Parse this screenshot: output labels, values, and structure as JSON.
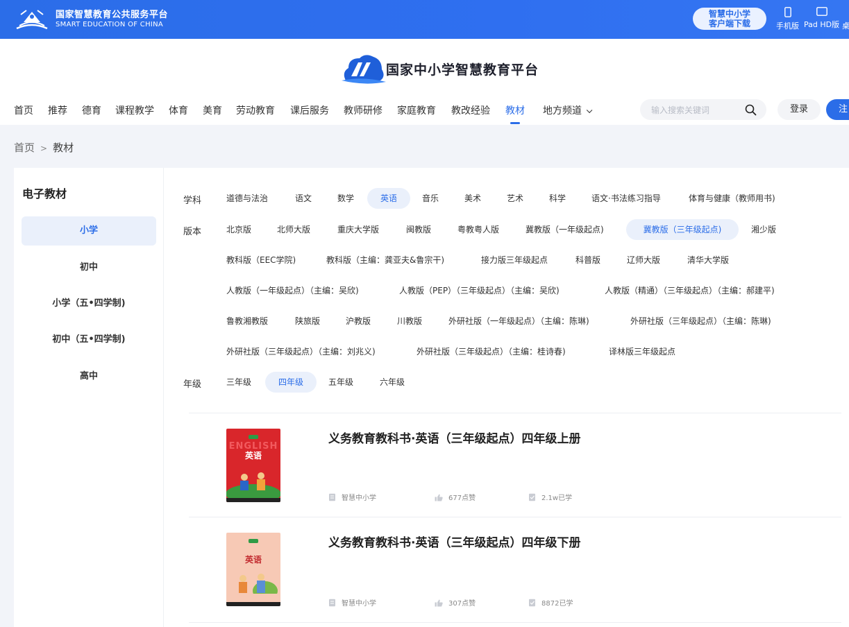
{
  "topbar": {
    "brand_cn": "国家智慧教育公共服务平台",
    "brand_en": "SMART EDUCATION OF CHINA",
    "client_line1": "智慧中小学",
    "client_line2": "客户端下载",
    "devices": [
      "手机版",
      "Pad HD版",
      "桌"
    ]
  },
  "header": {
    "site_title": "国家中小学智慧教育平台",
    "nav": [
      "首页",
      "推荐",
      "德育",
      "课程教学",
      "体育",
      "美育",
      "劳动教育",
      "课后服务",
      "教师研修",
      "家庭教育",
      "教改经验",
      "教材",
      "地方频道"
    ],
    "nav_active": "教材",
    "search_placeholder": "输入搜索关键词",
    "login": "登录",
    "register": "注"
  },
  "breadcrumb": {
    "home": "首页",
    "sep": ">",
    "current": "教材"
  },
  "sidebar": {
    "title": "电子教材",
    "stages": [
      "小学",
      "初中",
      "小学（五•四学制)",
      "初中（五•四学制)",
      "高中"
    ],
    "active": "小学"
  },
  "filters": {
    "subject_label": "学科",
    "subjects": [
      "道德与法治",
      "语文",
      "数学",
      "英语",
      "音乐",
      "美术",
      "艺术",
      "科学",
      "语文·书法练习指导",
      "体育与健康（教师用书)"
    ],
    "subject_active": "英语",
    "edition_label": "版本",
    "editions": [
      "北京版",
      "北师大版",
      "重庆大学版",
      "闽教版",
      "粤教粤人版",
      "冀教版（一年级起点)",
      "冀教版（三年级起点)",
      "湘少版",
      "教科版（EEC学院)",
      "教科版（主编：龚亚夫&鲁宗干)",
      "接力版三年级起点",
      "科普版",
      "辽师大版",
      "清华大学版",
      "人教版（一年级起点）（主编：吴欣)",
      "人教版（PEP）（三年级起点）（主编：吴欣)",
      "人教版（精通）（三年级起点）（主编：郝建平)",
      "鲁教湘教版",
      "陕旅版",
      "沪教版",
      "川教版",
      "外研社版（一年级起点）（主编：陈琳)",
      "外研社版（三年级起点）（主编：陈琳)",
      "外研社版（三年级起点）（主编：刘兆义)",
      "外研社版（三年级起点）（主编：桂诗春)",
      "译林版三年级起点"
    ],
    "edition_active": "冀教版（三年级起点)",
    "grade_label": "年级",
    "grades": [
      "三年级",
      "四年级",
      "五年级",
      "六年级"
    ],
    "grade_active": "四年级"
  },
  "books": [
    {
      "title": "义务教育教科书·英语（三年级起点）四年级上册",
      "source": "智慧中小学",
      "likes": "677点赞",
      "learners": "2.1w已学",
      "cover_word": "英语",
      "cover_en": "ENGLISH",
      "cover_color": "#d9262b"
    },
    {
      "title": "义务教育教科书·英语（三年级起点）四年级下册",
      "source": "智慧中小学",
      "likes": "307点赞",
      "learners": "8872已学",
      "cover_word": "英语",
      "cover_en": "",
      "cover_color": "#f7c9b5"
    }
  ],
  "colors": {
    "brand_blue": "#2b6de8",
    "active_bg": "#eaf0fb"
  }
}
